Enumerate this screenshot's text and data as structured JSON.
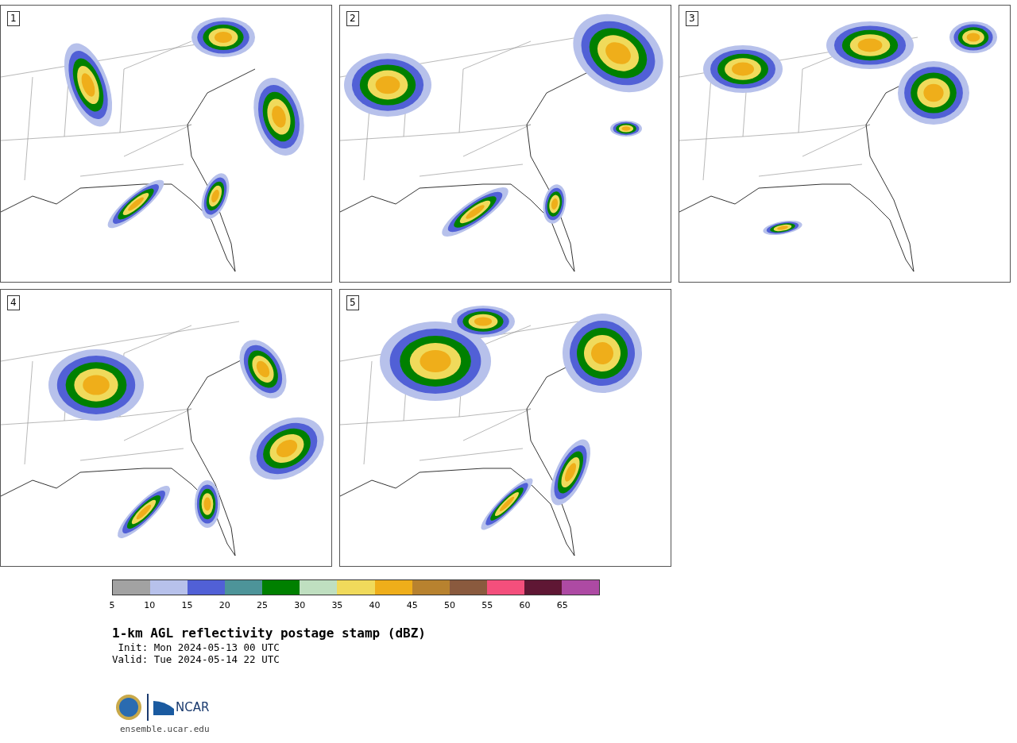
{
  "panels": [
    {
      "label": "1"
    },
    {
      "label": "2"
    },
    {
      "label": "3"
    },
    {
      "label": "4"
    },
    {
      "label": "5"
    }
  ],
  "colorbar": {
    "segments": [
      {
        "color": "#a2a2a2"
      },
      {
        "color": "#b7c1eb"
      },
      {
        "color": "#5160d6"
      },
      {
        "color": "#4d9499"
      },
      {
        "color": "#008000"
      },
      {
        "color": "#bfdfc0"
      },
      {
        "color": "#f0da5b"
      },
      {
        "color": "#efae1a"
      },
      {
        "color": "#b8822f"
      },
      {
        "color": "#8a5a3e"
      },
      {
        "color": "#f44f7c"
      },
      {
        "color": "#5f1734"
      },
      {
        "color": "#ad4aa3"
      }
    ],
    "ticks": [
      "5",
      "10",
      "15",
      "20",
      "25",
      "30",
      "35",
      "40",
      "45",
      "50",
      "55",
      "60",
      "65"
    ]
  },
  "title": "1-km AGL reflectivity postage stamp (dBZ)",
  "init": " Init: Mon 2024-05-13 00 UTC",
  "valid": "Valid: Tue 2024-05-14 22 UTC",
  "footer": {
    "logo_text": "NCAR",
    "url": "ensemble.ucar.edu"
  }
}
